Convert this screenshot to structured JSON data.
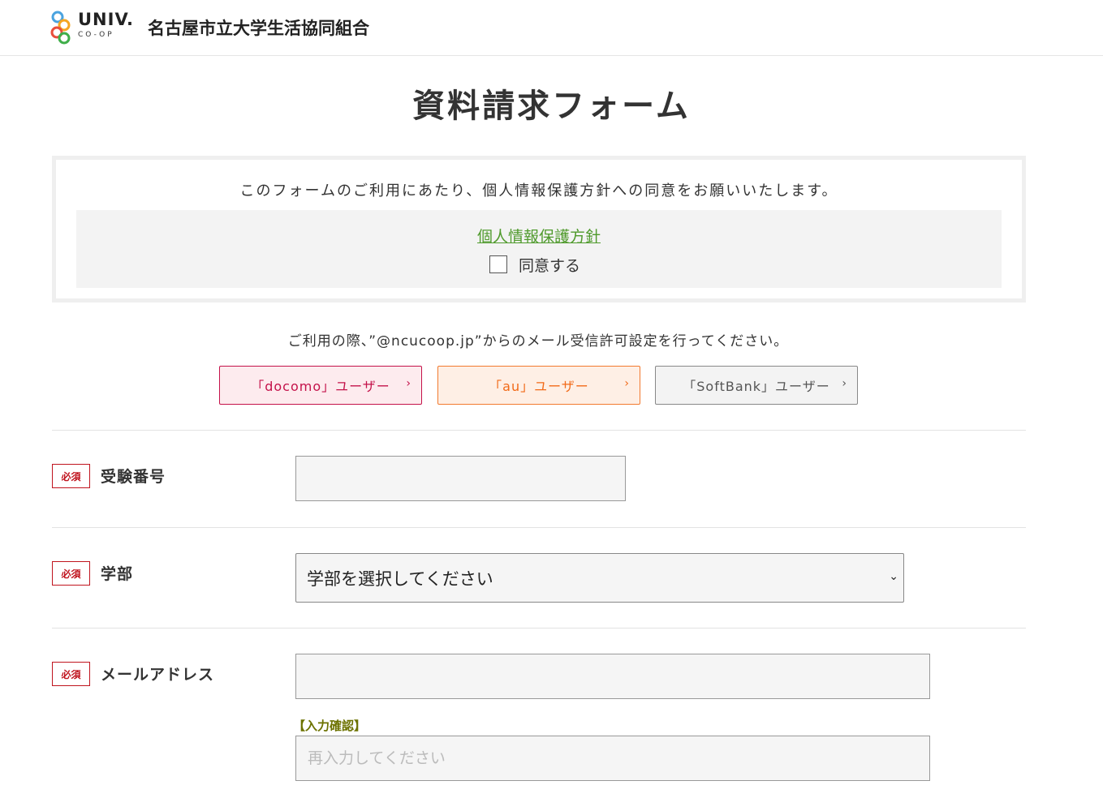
{
  "header": {
    "logo_text": "UNIV.",
    "logo_sub": "CO-OP",
    "org_name": "名古屋市立大学生活協同組合"
  },
  "page_title": "資料請求フォーム",
  "consent": {
    "message": "このフォームのご利用にあたり、個人情報保護方針への同意をお願いいたします。",
    "policy_link": "個人情報保護方針",
    "agree_label": "同意する"
  },
  "mail_note": "ご利用の際、”@ncucoop.jp”からのメール受信許可設定を行ってください。",
  "carriers": [
    {
      "label": "「docomo」ユーザー"
    },
    {
      "label": "「au」ユーザー"
    },
    {
      "label": "「SoftBank」ユーザー"
    }
  ],
  "required_badge": "必須",
  "fields": {
    "exam_number": {
      "label": "受験番号",
      "value": ""
    },
    "faculty": {
      "label": "学部",
      "selected": "学部を選択してください"
    },
    "email": {
      "label": "メールアドレス",
      "value": "",
      "confirm_label": "【入力確認】",
      "confirm_placeholder": "再入力してください"
    }
  },
  "colors": {
    "required": "#c0141e",
    "link_green": "#4f9a2c",
    "docomo": "#c4124a",
    "au": "#f26a18",
    "softbank": "#555555"
  }
}
